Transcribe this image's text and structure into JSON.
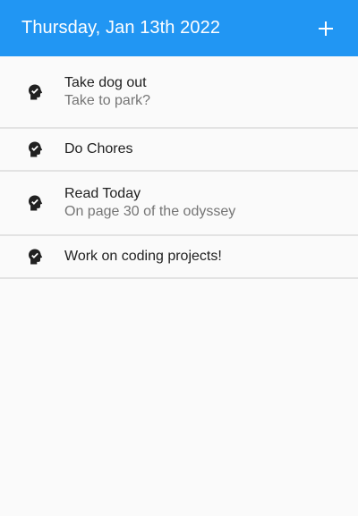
{
  "header": {
    "title": "Thursday, Jan 13th 2022",
    "add_icon": "plus-icon"
  },
  "colors": {
    "app_bar": "#2196f3",
    "background": "#fafafa",
    "title_text": "#212121",
    "subtitle_text": "#757575",
    "divider": "#e3e3e3"
  },
  "tasks": [
    {
      "title": "Take dog out",
      "subtitle": "Take to park?",
      "icon": "head-check-icon"
    },
    {
      "title": "Do Chores",
      "subtitle": "",
      "icon": "head-check-icon"
    },
    {
      "title": "Read Today",
      "subtitle": "On page 30 of the odyssey",
      "icon": "head-check-icon"
    },
    {
      "title": "Work on coding projects!",
      "subtitle": "",
      "icon": "head-check-icon"
    }
  ]
}
